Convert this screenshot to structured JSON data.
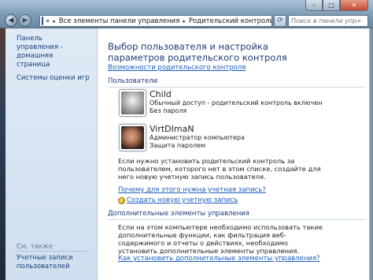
{
  "window": {
    "minimize_glyph": "–",
    "maximize_glyph": "□",
    "close_glyph": "✕"
  },
  "nav": {
    "back_glyph": "◀",
    "forward_glyph": "▶",
    "recent_glyph": "▼"
  },
  "address": {
    "prefix": "«",
    "crumbs": [
      "Все элементы панели управления",
      "Родительский контроль"
    ],
    "separator": "▸",
    "drop_glyph": "▼"
  },
  "refresh_glyph": "⟳",
  "search": {
    "placeholder": "Поиск в панели управления",
    "icon_glyph": "⌕"
  },
  "sidebar": {
    "links": [
      {
        "label": "Панель управления - домашняя страница"
      },
      {
        "label": "Системы оценки игр"
      }
    ],
    "see_also_label": "См. также",
    "see_also_link": "Учетные записи пользователей"
  },
  "main": {
    "title": "Выбор пользователя и настройка параметров родительского контроля",
    "parental_options_link": "Возможности родительского контроля",
    "users_group_label": "Пользователи",
    "users": [
      {
        "name": "Child",
        "line1": "Обычный доступ - родительский контроль включен",
        "line2": "Без пароля",
        "avatar": "robot-avatar"
      },
      {
        "name": "VirtDImaN",
        "line1": "Администратор компьютера",
        "line2": "Защита паролем",
        "avatar": "user-photo"
      }
    ],
    "info_text": "Если нужно установить родительский контроль за пользователем, которого нет в этом списке, создайте для него новую учетную запись пользователя.",
    "why_link": "Почему для этого нужна учетная запись?",
    "create_link": "Создать новую учетную запись",
    "extra_group_label": "Дополнительные элементы управления",
    "extra_text": "Если на этом компьютере необходимо использовать такие дополнительные функции, как фильтрация веб-содержимого и отчеты о действиях, необходимо установить дополнительные элементы управления.",
    "howto_link": "Как установить дополнительные элементы управления?"
  }
}
